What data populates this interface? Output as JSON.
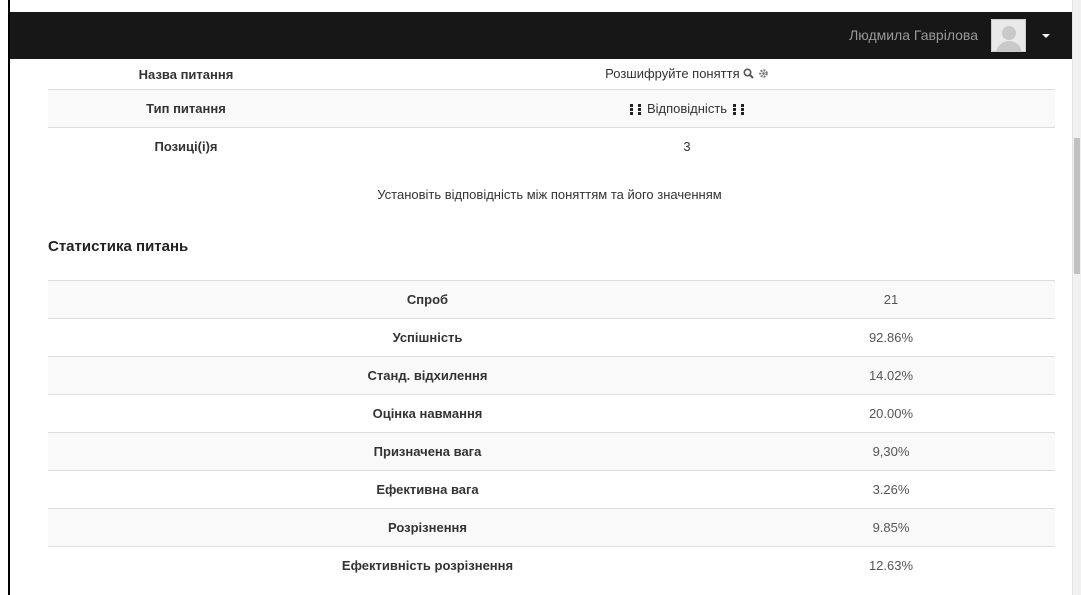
{
  "navbar": {
    "user_name": "Людмила Гаврілова",
    "avatar_icon": "user-avatar-icon",
    "menu_icon": "caret-down-icon"
  },
  "question_info": [
    {
      "label": "Назва питання",
      "value": "Розшифруйте поняття"
    },
    {
      "label": "Тип питання",
      "value": "Відповідність"
    },
    {
      "label": "Позиці(і)я",
      "value": "3"
    }
  ],
  "question_icons": [
    "preview-icon",
    "edit-gear-icon",
    "matching-type-icon"
  ],
  "description": "Установіть відповідність між поняттям та його значенням",
  "stats_title": "Статистика питань",
  "stats": [
    {
      "label": "Спроб",
      "value": "21"
    },
    {
      "label": "Успішність",
      "value": "92.86%"
    },
    {
      "label": "Станд. відхилення",
      "value": "14.02%"
    },
    {
      "label": "Оцінка навмання",
      "value": "20.00%"
    },
    {
      "label": "Призначена вага",
      "value": "9,30%"
    },
    {
      "label": "Ефективна вага",
      "value": "3.26%"
    },
    {
      "label": "Розрізнення",
      "value": "9.85%"
    },
    {
      "label": "Ефективність розрізнення",
      "value": "12.63%"
    }
  ]
}
